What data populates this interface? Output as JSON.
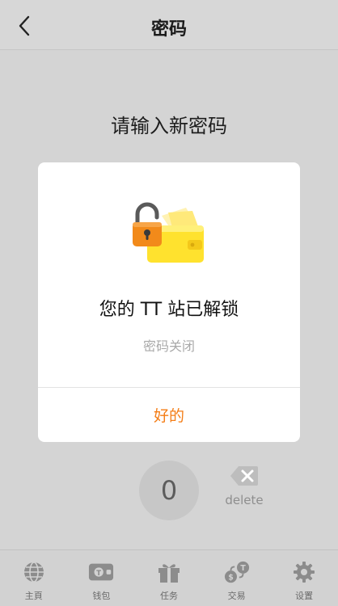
{
  "header": {
    "title": "密码",
    "back_icon": "chevron-left-icon"
  },
  "prompt": "请输入新密码",
  "keypad": {
    "zero_label": "0",
    "delete_label": "delete",
    "delete_icon": "backspace-icon"
  },
  "modal": {
    "illustration": "unlocked-wallet-icon",
    "title": "您的 TT 站已解锁",
    "subtitle": "密码关闭",
    "ok_label": "好的",
    "ok_color": "#f47d16"
  },
  "bottom_nav": {
    "items": [
      {
        "label": "主頁",
        "icon": "globe-icon"
      },
      {
        "label": "钱包",
        "icon": "wallet-icon"
      },
      {
        "label": "任务",
        "icon": "gift-icon"
      },
      {
        "label": "交易",
        "icon": "exchange-icon"
      },
      {
        "label": "设置",
        "icon": "gear-icon"
      }
    ]
  }
}
